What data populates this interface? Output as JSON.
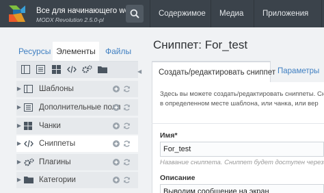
{
  "header": {
    "site_title": "Все для начинающего we...",
    "site_subtitle": "MODX Revolution 2.5.0-pl",
    "menu": [
      "Содержимое",
      "Медиа",
      "Приложения"
    ]
  },
  "sidebar": {
    "tabs": [
      "Ресурсы",
      "Элементы",
      "Файлы"
    ],
    "active_tab": "Элементы",
    "tree": [
      {
        "label": "Шаблоны",
        "icon": "layout-icon"
      },
      {
        "label": "Дополнительные поля",
        "icon": "list-icon"
      },
      {
        "label": "Чанки",
        "icon": "grid-icon"
      },
      {
        "label": "Сниппеты",
        "icon": "code-icon",
        "active": true
      },
      {
        "label": "Плагины",
        "icon": "cogs-icon"
      },
      {
        "label": "Категории",
        "icon": "folder-icon"
      }
    ]
  },
  "main": {
    "title": "Сниппет: For_test",
    "tabs": [
      "Создать/редактировать сниппет",
      "Параметры"
    ],
    "description_line1": "Здесь вы можете создать/редактировать сниппеты. Сниппеты",
    "description_line2": "в определенном месте шаблона, или чанка, или вер",
    "name_label": "Имя*",
    "name_value": "For_test",
    "name_hint": "Название сниппета. Сниппет будет доступен через т",
    "description_label": "Описание",
    "description_value": "Выводим сообщение на экран"
  },
  "colors": {
    "topbar": "#3b434b",
    "link": "#3f7fc1",
    "panel_bg": "#f0f2f4"
  }
}
